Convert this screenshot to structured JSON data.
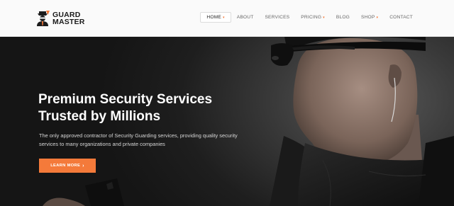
{
  "brand": {
    "line1": "GUARD",
    "line2": "MASTER",
    "accent_color": "#f47a3a"
  },
  "nav": {
    "items": [
      {
        "label": "HOME",
        "caret": "▾",
        "active": true
      },
      {
        "label": "ABOUT"
      },
      {
        "label": "SERVICES"
      },
      {
        "label": "PRICING",
        "caret": "▾"
      },
      {
        "label": "BLOG"
      },
      {
        "label": "SHOP",
        "caret": "▾"
      },
      {
        "label": "CONTACT"
      }
    ]
  },
  "hero": {
    "title_line1": "Premium Security Services",
    "title_line2": "Trusted by Millions",
    "text": "The only approved contractor of Security Guarding services, providing quality security services to many organizations and private companies",
    "cta_label": "LEARN MORE",
    "cta_arrow": "›"
  },
  "colors": {
    "accent": "#f47a3a",
    "header_bg": "#fafafa",
    "hero_bg": "#1e1e1e"
  }
}
